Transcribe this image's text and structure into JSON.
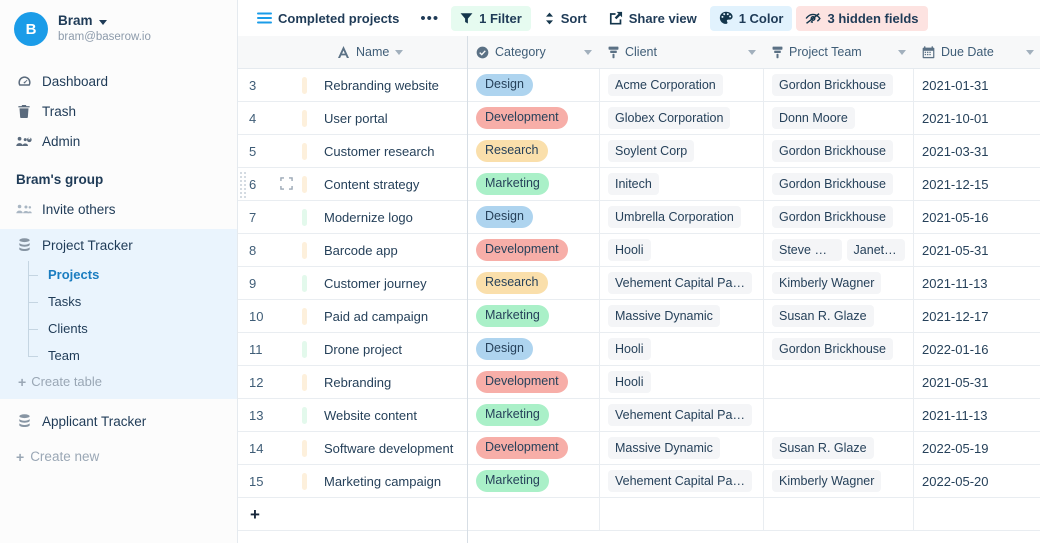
{
  "sidebar": {
    "user": {
      "initial": "B",
      "name": "Bram",
      "email": "bram@baserow.io"
    },
    "nav": [
      {
        "label": "Dashboard",
        "icon": "dashboard-icon"
      },
      {
        "label": "Trash",
        "icon": "trash-icon"
      },
      {
        "label": "Admin",
        "icon": "admin-icon"
      }
    ],
    "group_title": "Bram's group",
    "invite_label": "Invite others",
    "databases": [
      {
        "name": "Project Tracker",
        "active": true,
        "tables": [
          "Projects",
          "Tasks",
          "Clients",
          "Team"
        ],
        "selected_table": "Projects",
        "create_table_label": "Create table"
      },
      {
        "name": "Applicant Tracker",
        "active": false,
        "tables": []
      }
    ],
    "create_new_label": "Create new"
  },
  "toolbar": {
    "view_name": "Completed projects",
    "more_label": "•••",
    "filter_label": "1 Filter",
    "sort_label": "Sort",
    "share_label": "Share view",
    "color_label": "1 Color",
    "hidden_fields_label": "3 hidden fields",
    "colors": {
      "filter_bg": "#e6fbf0",
      "color_bg": "#e1f2fd",
      "hidden_bg": "#fde3e1"
    }
  },
  "grid": {
    "columns": [
      {
        "label": "Name",
        "icon": "text-field-icon",
        "key": "name"
      },
      {
        "label": "Category",
        "icon": "single-select-icon",
        "key": "category"
      },
      {
        "label": "Client",
        "icon": "link-row-icon",
        "key": "client"
      },
      {
        "label": "Project Team",
        "icon": "link-row-icon",
        "key": "team"
      },
      {
        "label": "Due Date",
        "icon": "calendar-icon",
        "key": "due_date"
      }
    ],
    "add_row_label": "+",
    "category_colors": {
      "Design": "#aed4ef",
      "Development": "#f7aea8",
      "Research": "#fadfab",
      "Marketing": "#aaf0c8"
    },
    "row_color_values": {
      "orange": "#fdf0dc",
      "green": "#e3f9ec"
    },
    "rows": [
      {
        "num": "3",
        "color": "orange",
        "name": "Rebranding website",
        "category": "Design",
        "client": "Acme Corporation",
        "team": [
          "Gordon Brickhouse"
        ],
        "due_date": "2021-01-31",
        "hovered": false
      },
      {
        "num": "4",
        "color": "orange",
        "name": "User portal",
        "category": "Development",
        "client": "Globex Corporation",
        "team": [
          "Donn Moore"
        ],
        "due_date": "2021-10-01",
        "hovered": false
      },
      {
        "num": "5",
        "color": "orange",
        "name": "Customer research",
        "category": "Research",
        "client": "Soylent Corp",
        "team": [
          "Gordon Brickhouse"
        ],
        "due_date": "2021-03-31",
        "hovered": false
      },
      {
        "num": "6",
        "color": "orange",
        "name": "Content strategy",
        "category": "Marketing",
        "client": "Initech",
        "team": [
          "Gordon Brickhouse"
        ],
        "due_date": "2021-12-15",
        "hovered": true
      },
      {
        "num": "7",
        "color": "green",
        "name": "Modernize logo",
        "category": "Design",
        "client": "Umbrella Corporation",
        "team": [
          "Gordon Brickhouse"
        ],
        "due_date": "2021-05-16",
        "hovered": false
      },
      {
        "num": "8",
        "color": "orange",
        "name": "Barcode app",
        "category": "Development",
        "client": "Hooli",
        "team": [
          "Steve Gray",
          "Janet Co"
        ],
        "due_date": "2021-05-31",
        "hovered": false
      },
      {
        "num": "9",
        "color": "green",
        "name": "Customer journey",
        "category": "Research",
        "client": "Vehement Capital Pa…",
        "team": [
          "Kimberly Wagner"
        ],
        "due_date": "2021-11-13",
        "hovered": false
      },
      {
        "num": "10",
        "color": "orange",
        "name": "Paid ad campaign",
        "category": "Marketing",
        "client": "Massive Dynamic",
        "team": [
          "Susan R. Glaze"
        ],
        "due_date": "2021-12-17",
        "hovered": false
      },
      {
        "num": "11",
        "color": "green",
        "name": "Drone project",
        "category": "Design",
        "client": "Hooli",
        "team": [
          "Gordon Brickhouse"
        ],
        "due_date": "2022-01-16",
        "hovered": false
      },
      {
        "num": "12",
        "color": "orange",
        "name": "Rebranding",
        "category": "Development",
        "client": "Hooli",
        "team": [],
        "due_date": "2021-05-31",
        "hovered": false
      },
      {
        "num": "13",
        "color": "green",
        "name": "Website content",
        "category": "Marketing",
        "client": "Vehement Capital Pa…",
        "team": [],
        "due_date": "2021-11-13",
        "hovered": false
      },
      {
        "num": "14",
        "color": "orange",
        "name": "Software development",
        "category": "Development",
        "client": "Massive Dynamic",
        "team": [
          "Susan R. Glaze"
        ],
        "due_date": "2022-05-19",
        "hovered": false
      },
      {
        "num": "15",
        "color": "orange",
        "name": "Marketing campaign",
        "category": "Marketing",
        "client": "Vehement Capital Pa…",
        "team": [
          "Kimberly Wagner"
        ],
        "due_date": "2022-05-20",
        "hovered": false
      }
    ]
  }
}
